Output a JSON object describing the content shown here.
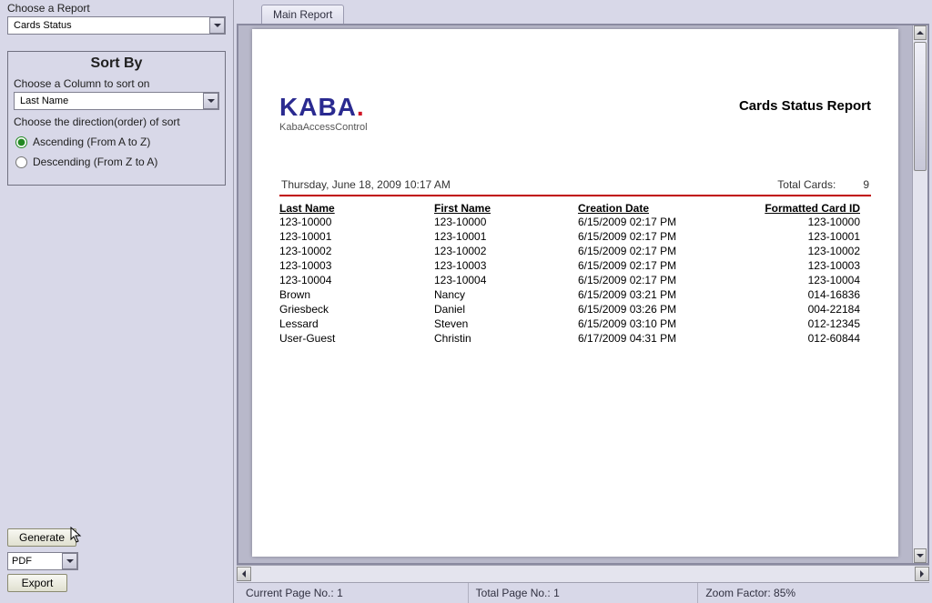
{
  "left": {
    "choose_report_label": "Choose a Report",
    "report_selected": "Cards Status",
    "sort_title": "Sort By",
    "column_instr": "Choose a Column to sort on",
    "column_selected": "Last Name",
    "order_instr": "Choose the direction(order) of sort",
    "asc_label": "Ascending (From A to Z)",
    "desc_label": "Descending (From Z to A)",
    "generate_label": "Generate",
    "format_selected": "PDF",
    "export_label": "Export"
  },
  "tabs": {
    "main": "Main Report"
  },
  "report": {
    "brand": "KABA",
    "brand_sub": "KabaAccessControl",
    "title": "Cards Status Report",
    "datetime": "Thursday, June 18, 2009 10:17 AM",
    "total_label": "Total Cards:",
    "total_value": "9",
    "columns": {
      "ln": "Last Name",
      "fn": "First Name",
      "cd": "Creation Date",
      "id": "Formatted Card ID"
    },
    "rows": [
      {
        "ln": "123-10000",
        "fn": "123-10000",
        "cd": "6/15/2009 02:17 PM",
        "id": "123-10000"
      },
      {
        "ln": "123-10001",
        "fn": "123-10001",
        "cd": "6/15/2009 02:17 PM",
        "id": "123-10001"
      },
      {
        "ln": "123-10002",
        "fn": "123-10002",
        "cd": "6/15/2009 02:17 PM",
        "id": "123-10002"
      },
      {
        "ln": "123-10003",
        "fn": "123-10003",
        "cd": "6/15/2009 02:17 PM",
        "id": "123-10003"
      },
      {
        "ln": "123-10004",
        "fn": "123-10004",
        "cd": "6/15/2009 02:17 PM",
        "id": "123-10004"
      },
      {
        "ln": "Brown",
        "fn": "Nancy",
        "cd": "6/15/2009 03:21 PM",
        "id": "014-16836"
      },
      {
        "ln": "Griesbeck",
        "fn": "Daniel",
        "cd": "6/15/2009 03:26 PM",
        "id": "004-22184"
      },
      {
        "ln": "Lessard",
        "fn": "Steven",
        "cd": "6/15/2009 03:10 PM",
        "id": "012-12345"
      },
      {
        "ln": "User-Guest",
        "fn": "Christin",
        "cd": "6/17/2009 04:31 PM",
        "id": "012-60844"
      }
    ]
  },
  "status": {
    "current_page_label": "Current Page No.:",
    "current_page": "1",
    "total_page_label": "Total Page No.:",
    "total_page": "1",
    "zoom_label": "Zoom Factor:",
    "zoom": "85%"
  }
}
